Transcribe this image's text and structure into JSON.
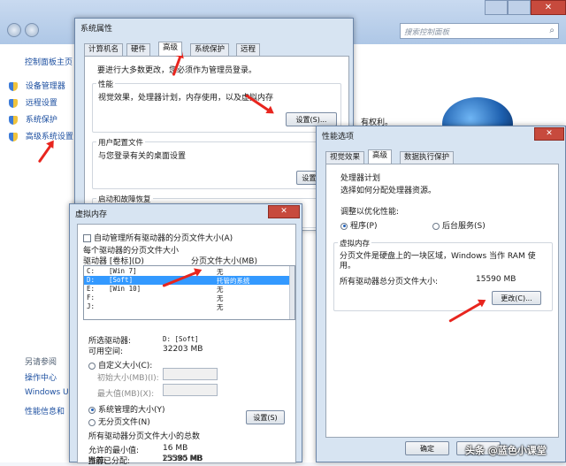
{
  "control_panel": {
    "search_placeholder": "搜索控制面板",
    "nav_home": "控制面板主页",
    "nav_items": [
      "设备管理器",
      "远程设置",
      "系统保护",
      "高级系统设置"
    ],
    "see_also": "另请参阅",
    "see_also_items": [
      "操作中心",
      "Windows U",
      "性能信息和"
    ],
    "partial_right_text": "有权利。"
  },
  "sysprops": {
    "title": "系统属性",
    "tabs": [
      "计算机名",
      "硬件",
      "高级",
      "系统保护",
      "远程"
    ],
    "admin_note": "要进行大多数更改，您必须作为管理员登录。",
    "perf_group": "性能",
    "perf_desc": "视觉效果，处理器计划，内存使用，以及虚拟内存",
    "perf_settings_btn": "设置(S)...",
    "profile_group": "用户配置文件",
    "profile_desc": "与您登录有关的桌面设置",
    "profile_settings_btn": "设置(E)",
    "startup_group": "启动和故障恢复"
  },
  "perfopts": {
    "title": "性能选项",
    "tabs": [
      "视觉效果",
      "高级",
      "数据执行保护"
    ],
    "cpu_group": "处理器计划",
    "cpu_desc": "选择如何分配处理器资源。",
    "adjust_label": "调整以优化性能:",
    "opt_programs": "程序(P)",
    "opt_services": "后台服务(S)",
    "vm_group": "虚拟内存",
    "vm_desc": "分页文件是硬盘上的一块区域，Windows 当作 RAM 使用。",
    "vm_total_label": "所有驱动器总分页文件大小:",
    "vm_total_value": "15590 MB",
    "change_btn": "更改(C)...",
    "ok_btn": "确定",
    "watermark": "头条 @蓝色小课堂"
  },
  "vmem": {
    "title": "虚拟内存",
    "auto_manage": "自动管理所有驱动器的分页文件大小(A)",
    "per_drive_label": "每个驱动器的分页文件大小",
    "col_drive": "驱动器 [卷标](D)",
    "col_size": "分页文件大小(MB)",
    "drives": [
      {
        "drive": "C:",
        "label": "[Win 7]",
        "size": "无"
      },
      {
        "drive": "D:",
        "label": "[Soft]",
        "size": "托管的系统"
      },
      {
        "drive": "E:",
        "label": "[Win 10]",
        "size": "无"
      },
      {
        "drive": "F:",
        "label": "",
        "size": "无"
      },
      {
        "drive": "J:",
        "label": "",
        "size": "无"
      }
    ],
    "selected_drive_label": "所选驱动器:",
    "selected_drive_value": "D:  [Soft]",
    "free_space_label": "可用空间:",
    "free_space_value": "32203 MB",
    "custom_size": "自定义大小(C):",
    "initial_size": "初始大小(MB)(I):",
    "max_size": "最大值(MB)(X):",
    "system_managed": "系统管理的大小(Y)",
    "no_paging": "无分页文件(N)",
    "set_btn": "设置(S)",
    "total_group": "所有驱动器分页文件大小的总数",
    "min_allowed_label": "允许的最小值:",
    "min_allowed_value": "16 MB",
    "recommended_label": "推荐:",
    "recommended_value": "23385 MB",
    "current_label": "当前已分配:",
    "current_value": "15590 MB"
  },
  "colors": {
    "arrow": "#e8251e",
    "selection": "#3399ff",
    "link": "#1c4fa0"
  }
}
